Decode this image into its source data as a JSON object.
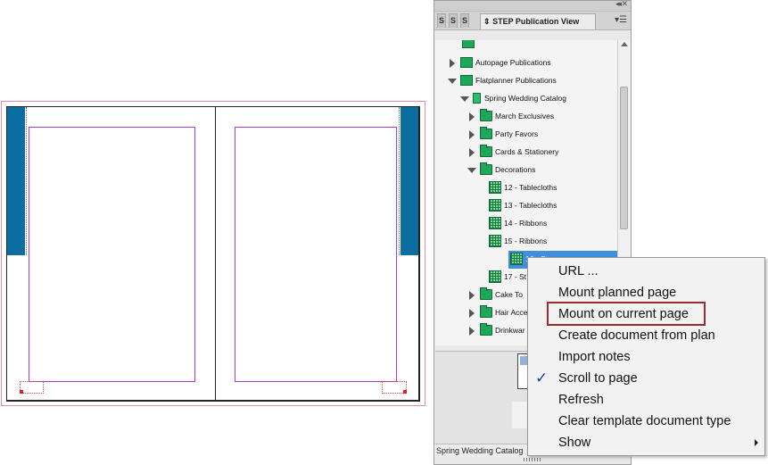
{
  "panel": {
    "title": "STEP Publication View",
    "mini_tabs": [
      "S",
      "S",
      "S"
    ],
    "collapse_glyph": "◂◂",
    "close_glyph": "✕",
    "menu_glyph": "▾☰",
    "status": "Spring Wedding Catalog"
  },
  "tree": {
    "rows": [
      {
        "label": "Autopage Publications",
        "icon": "publication-icon",
        "expanded": false
      },
      {
        "label": "Flatplanner Publications",
        "icon": "publication-icon",
        "expanded": true
      },
      {
        "label": "Spring Wedding Catalog",
        "icon": "catalog-icon",
        "expanded": true
      },
      {
        "label": "March Exclusives",
        "icon": "folder-icon",
        "expanded": false
      },
      {
        "label": "Party Favors",
        "icon": "folder-icon",
        "expanded": false
      },
      {
        "label": "Cards & Stationery",
        "icon": "folder-icon",
        "expanded": false
      },
      {
        "label": "Decorations",
        "icon": "folder-icon",
        "expanded": true
      },
      {
        "label": "12 - Tablecloths",
        "icon": "page-icon"
      },
      {
        "label": "13 - Tablecloths",
        "icon": "page-icon"
      },
      {
        "label": "14 - Ribbons",
        "icon": "page-icon"
      },
      {
        "label": "15 - Ribbons",
        "icon": "page-icon"
      },
      {
        "label": "16 - St",
        "icon": "page-icon",
        "selected": true
      },
      {
        "label": "17 - St",
        "icon": "page-icon"
      },
      {
        "label": "Cake To",
        "icon": "folder-icon",
        "expanded": false
      },
      {
        "label": "Hair Acce",
        "icon": "folder-icon",
        "expanded": false
      },
      {
        "label": "Drinkwar",
        "icon": "folder-icon",
        "expanded": false
      }
    ]
  },
  "context_menu": {
    "items": [
      {
        "label": "URL ..."
      },
      {
        "label": "Mount planned page"
      },
      {
        "label": "Mount on current page",
        "highlighted": true
      },
      {
        "label": "Create document from plan"
      },
      {
        "label": "Import notes"
      },
      {
        "label": "Scroll to page",
        "checked": true
      },
      {
        "label": "Refresh"
      },
      {
        "label": "Clear template document type"
      },
      {
        "label": "Show",
        "has_submenu": true
      }
    ],
    "check_glyph": "✓",
    "highlight_color": "#9e2b2b"
  },
  "colors": {
    "page_accent": "#0b6da0",
    "margin_guide": "#a23bd9",
    "bleed_guide": "#e58ab0",
    "tree_selection": "#3f8fe0",
    "folder": "#1ea65b"
  }
}
